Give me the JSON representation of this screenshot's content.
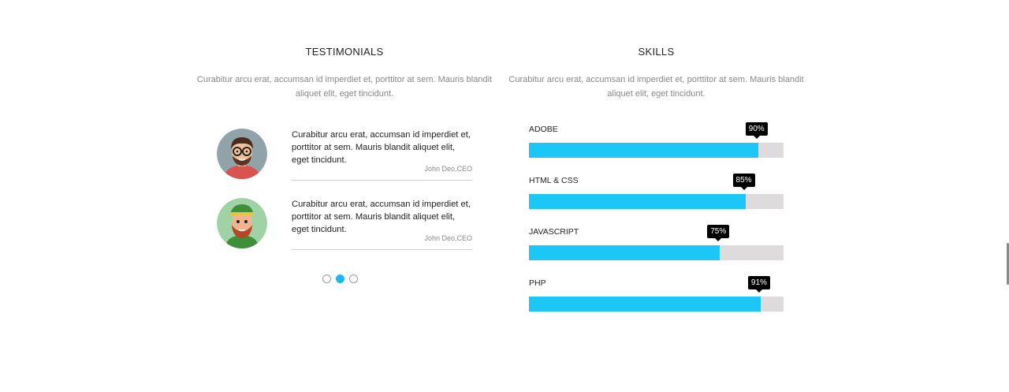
{
  "testimonials": {
    "title": "TESTIMONIALS",
    "description": "Curabitur arcu erat, accumsan id imperdiet et, porttitor at sem. Mauris blandit aliquet elit, eget tincidunt.",
    "items": [
      {
        "quote": "Curabitur arcu erat, accumsan id imperdiet et, porttitor at sem. Mauris blandit aliquet elit, eget tincidunt.",
        "author": "John Deo,CEO",
        "avatar": "man-with-glasses-avatar"
      },
      {
        "quote": "Curabitur arcu erat, accumsan id imperdiet et, porttitor at sem. Mauris blandit aliquet elit, eget tincidunt.",
        "author": "John Deo,CEO",
        "avatar": "bearded-man-green-hat-avatar"
      }
    ],
    "pagination": {
      "count": 3,
      "active_index": 1
    }
  },
  "skills": {
    "title": "SKILLS",
    "description": "Curabitur arcu erat, accumsan id imperdiet et, porttitor at sem. Mauris blandit aliquet elit, eget tincidunt.",
    "items": [
      {
        "label": "ADOBE",
        "percent_label": "90%",
        "value": 0.9
      },
      {
        "label": "HTML & CSS",
        "percent_label": "85%",
        "value": 0.85
      },
      {
        "label": "JAVASCRIPT",
        "percent_label": "75%",
        "value": 0.75
      },
      {
        "label": "PHP",
        "percent_label": "91%",
        "value": 0.91
      }
    ],
    "colors": {
      "fill": "#1cc7f8",
      "track": "#dedbdc",
      "tooltip": "#000000"
    }
  },
  "accent_color": "#1fb6ee"
}
